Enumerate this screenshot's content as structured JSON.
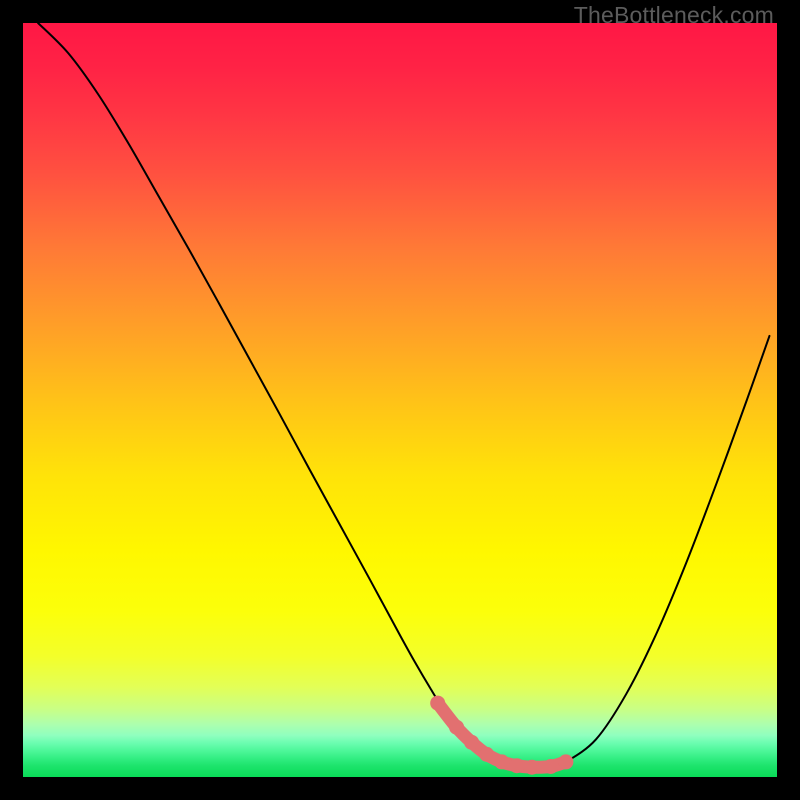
{
  "watermark": "TheBottleneck.com",
  "colors": {
    "black": "#000000",
    "curve": "#000000",
    "marker_fill": "#e27070",
    "marker_stroke": "#d85c5c",
    "grad_stops": [
      {
        "o": 0.0,
        "c": "#ff1745"
      },
      {
        "o": 0.06,
        "c": "#ff2345"
      },
      {
        "o": 0.12,
        "c": "#ff3544"
      },
      {
        "o": 0.2,
        "c": "#ff5140"
      },
      {
        "o": 0.3,
        "c": "#ff7a36"
      },
      {
        "o": 0.4,
        "c": "#ff9e28"
      },
      {
        "o": 0.5,
        "c": "#ffc218"
      },
      {
        "o": 0.6,
        "c": "#ffe309"
      },
      {
        "o": 0.7,
        "c": "#fff700"
      },
      {
        "o": 0.78,
        "c": "#fcff0a"
      },
      {
        "o": 0.84,
        "c": "#f3ff2a"
      },
      {
        "o": 0.88,
        "c": "#e3ff56"
      },
      {
        "o": 0.91,
        "c": "#c9ff85"
      },
      {
        "o": 0.93,
        "c": "#adffae"
      },
      {
        "o": 0.945,
        "c": "#8fffbf"
      },
      {
        "o": 0.955,
        "c": "#6bfdb0"
      },
      {
        "o": 0.965,
        "c": "#4ef79a"
      },
      {
        "o": 0.975,
        "c": "#33ee83"
      },
      {
        "o": 0.985,
        "c": "#1de46c"
      },
      {
        "o": 1.0,
        "c": "#0adb58"
      }
    ]
  },
  "chart_data": {
    "type": "line",
    "title": "",
    "xlabel": "",
    "ylabel": "",
    "xlim": [
      0,
      100
    ],
    "ylim": [
      0,
      100
    ],
    "grid": false,
    "series": [
      {
        "name": "bottleneck-curve",
        "x": [
          2,
          6,
          10,
          14,
          18,
          22,
          26,
          30,
          34,
          38,
          42,
          46,
          50,
          52,
          54,
          56,
          58,
          60,
          62,
          64,
          66,
          68,
          70,
          72,
          76,
          80,
          84,
          88,
          92,
          96,
          99
        ],
        "y": [
          100,
          96,
          90.5,
          84,
          77,
          70,
          62.8,
          55.5,
          48.2,
          40.8,
          33.5,
          26.2,
          18.8,
          15.2,
          11.8,
          8.6,
          6.0,
          4.0,
          2.6,
          1.8,
          1.4,
          1.3,
          1.4,
          2.0,
          5.0,
          11.0,
          19.0,
          28.5,
          39.0,
          50.0,
          58.5
        ]
      }
    ],
    "markers": {
      "name": "optimum-band",
      "x": [
        55.0,
        57.5,
        59.5,
        61.5,
        63.5,
        65.5,
        67.5,
        70.0,
        72.0
      ],
      "y": [
        9.8,
        6.6,
        4.6,
        3.0,
        2.0,
        1.5,
        1.3,
        1.4,
        2.0
      ]
    }
  }
}
